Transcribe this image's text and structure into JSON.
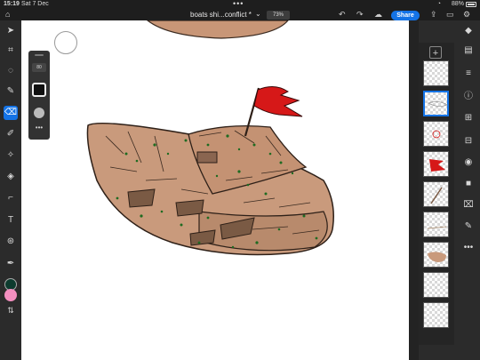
{
  "status": {
    "time": "15:19",
    "date": "Sat 7 Dec",
    "battery": "88%"
  },
  "top": {
    "doc_title": "boats shi...conflict *",
    "zoom": "73%",
    "share_label": "Share"
  },
  "brush": {
    "size": "80"
  },
  "colors": {
    "primary": "#0d3b2e",
    "secondary": "#f48fc0",
    "accent": "#1473e6"
  },
  "left_tools": [
    "home-icon",
    "move-icon",
    "transform-icon",
    "lasso-icon",
    "brush-icon",
    "eraser-icon",
    "healing-icon",
    "smudge-icon",
    "fill-icon",
    "gradient-icon",
    "crop-icon",
    "type-icon",
    "image-icon",
    "eyedropper-icon",
    "swap-icon"
  ],
  "right_rail": [
    "layers-icon",
    "layer-props-icon",
    "adjust-icon",
    "info-icon",
    "add-layer-icon",
    "visibility-icon",
    "mask-icon",
    "fill-layer-icon",
    "eraser-layer-icon",
    "more-icon"
  ]
}
